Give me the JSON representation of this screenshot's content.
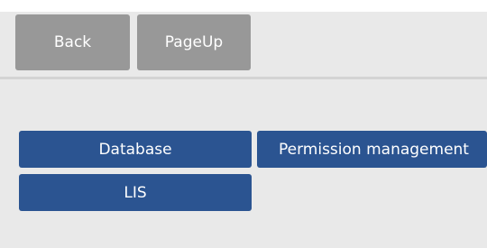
{
  "toolbar": {
    "back_label": "Back",
    "pageup_label": "PageUp"
  },
  "menu": {
    "items": [
      {
        "label": "Database"
      },
      {
        "label": "Permission management"
      },
      {
        "label": "LIS"
      }
    ]
  },
  "colors": {
    "toolbar_button": "#989898",
    "menu_button": "#2b5491",
    "background": "#e9e9e9",
    "divider": "#d3d3d3"
  }
}
